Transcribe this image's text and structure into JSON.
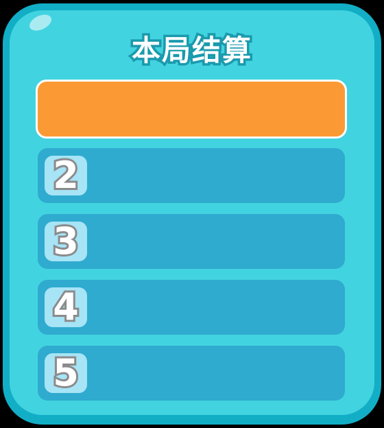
{
  "title": "本局结算",
  "colors": {
    "panel_border": "#12aec6",
    "panel_fill": "#42d3e0",
    "row_fill": "#2fabcf",
    "first_row_fill": "#fb9a35",
    "badge_fill": "#a6e4f6",
    "number_outline": "#8b8b8b"
  },
  "rows": [
    {
      "rank": "",
      "name": ""
    },
    {
      "rank": "2",
      "name": ""
    },
    {
      "rank": "3",
      "name": ""
    },
    {
      "rank": "4",
      "name": ""
    },
    {
      "rank": "5",
      "name": ""
    }
  ]
}
